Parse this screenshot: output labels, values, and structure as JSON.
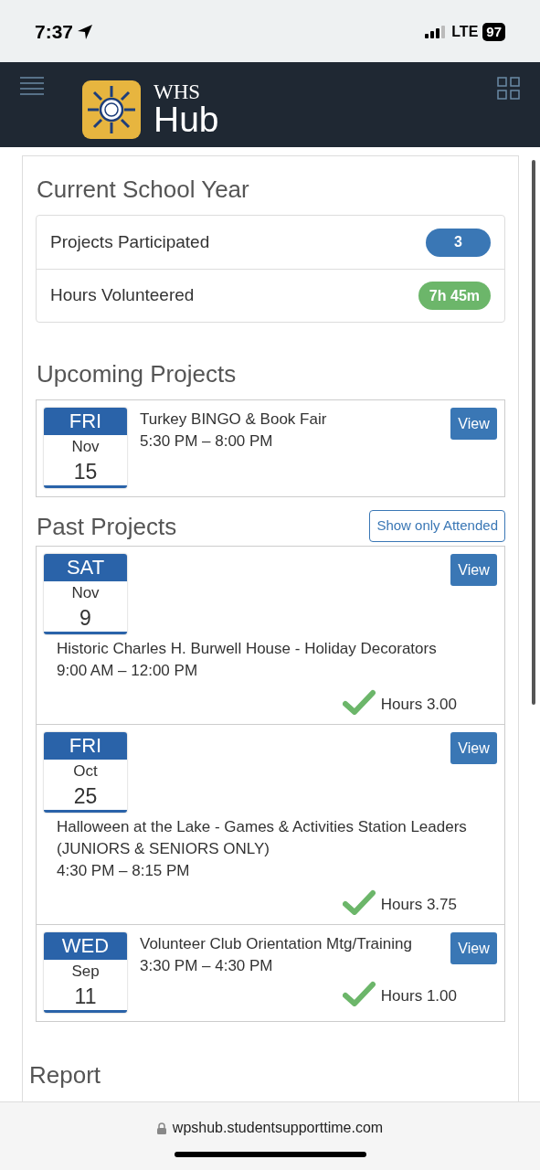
{
  "status_bar": {
    "time": "7:37",
    "network": "LTE",
    "battery": "97"
  },
  "header": {
    "logo_top": "WHS",
    "logo_bottom": "Hub"
  },
  "current_year": {
    "title": "Current School Year",
    "stats": [
      {
        "label": "Projects Participated",
        "value": "3",
        "color": "#3a77b5"
      },
      {
        "label": "Hours Volunteered",
        "value": "7h 45m",
        "color": "#6cb66a"
      }
    ]
  },
  "upcoming": {
    "title": "Upcoming Projects",
    "projects": [
      {
        "kind": "inline",
        "day": "FRI",
        "month": "Nov",
        "date": "15",
        "title": "Turkey BINGO & Book Fair",
        "time": "5:30 PM – 8:00 PM",
        "button": "View"
      }
    ]
  },
  "past": {
    "title": "Past Projects",
    "filter_button": "Show only Attended",
    "projects": [
      {
        "kind": "stacked",
        "day": "SAT",
        "month": "Nov",
        "date": "9",
        "title": "Historic Charles H. Burwell House - Holiday Decorators",
        "time": "9:00 AM – 12:00 PM",
        "button": "View",
        "attended": true,
        "hours": "Hours 3.00"
      },
      {
        "kind": "stacked",
        "day": "FRI",
        "month": "Oct",
        "date": "25",
        "title": "Halloween at the Lake - Games & Activities Station Leaders (JUNIORS & SENIORS ONLY)",
        "time": "4:30 PM – 8:15 PM",
        "button": "View",
        "attended": true,
        "hours": "Hours 3.75"
      },
      {
        "kind": "inline",
        "day": "WED",
        "month": "Sep",
        "date": "11",
        "title": "Volunteer Club Orientation Mtg/Training",
        "time": "3:30 PM – 4:30 PM",
        "button": "View",
        "attended": true,
        "hours": "Hours 1.00"
      }
    ]
  },
  "report": {
    "title": "Report"
  },
  "browser": {
    "url": "wpshub.studentsupporttime.com"
  }
}
